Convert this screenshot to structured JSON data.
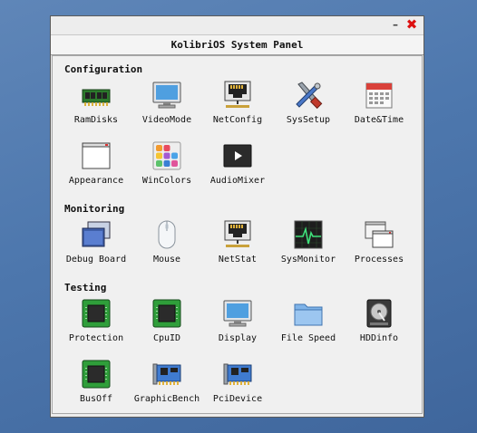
{
  "window": {
    "title": "KolibriOS System Panel",
    "minimize_glyph": "–",
    "close_glyph": "✖"
  },
  "sections": {
    "configuration": {
      "title": "Configuration",
      "items": [
        {
          "label": "RamDisks",
          "icon": "ram-icon"
        },
        {
          "label": "VideoMode",
          "icon": "monitor-icon"
        },
        {
          "label": "NetConfig",
          "icon": "network-port-icon"
        },
        {
          "label": "SysSetup",
          "icon": "tools-icon"
        },
        {
          "label": "Date&Time",
          "icon": "calendar-icon"
        },
        {
          "label": "Appearance",
          "icon": "window-icon"
        },
        {
          "label": "WinColors",
          "icon": "color-palette-icon"
        },
        {
          "label": "AudioMixer",
          "icon": "play-icon"
        }
      ]
    },
    "monitoring": {
      "title": "Monitoring",
      "items": [
        {
          "label": "Debug Board",
          "icon": "overlapping-windows-icon"
        },
        {
          "label": "Mouse",
          "icon": "mouse-icon"
        },
        {
          "label": "NetStat",
          "icon": "network-port-icon"
        },
        {
          "label": "SysMonitor",
          "icon": "heartbeat-monitor-icon"
        },
        {
          "label": "Processes",
          "icon": "process-windows-icon"
        }
      ]
    },
    "testing": {
      "title": "Testing",
      "items": [
        {
          "label": "Protection",
          "icon": "chip-icon"
        },
        {
          "label": "CpuID",
          "icon": "chip-icon"
        },
        {
          "label": "Display",
          "icon": "monitor-icon"
        },
        {
          "label": "File Speed",
          "icon": "folder-icon"
        },
        {
          "label": "HDDinfo",
          "icon": "hard-disk-icon"
        },
        {
          "label": "BusOff",
          "icon": "chip-icon"
        },
        {
          "label": "GraphicBench",
          "icon": "expansion-card-icon"
        },
        {
          "label": "PciDevice",
          "icon": "expansion-card-icon"
        }
      ]
    }
  },
  "colors": {
    "desktop": "#4d77ad",
    "close": "#d11111",
    "chip_green": "#2f9e3a"
  }
}
